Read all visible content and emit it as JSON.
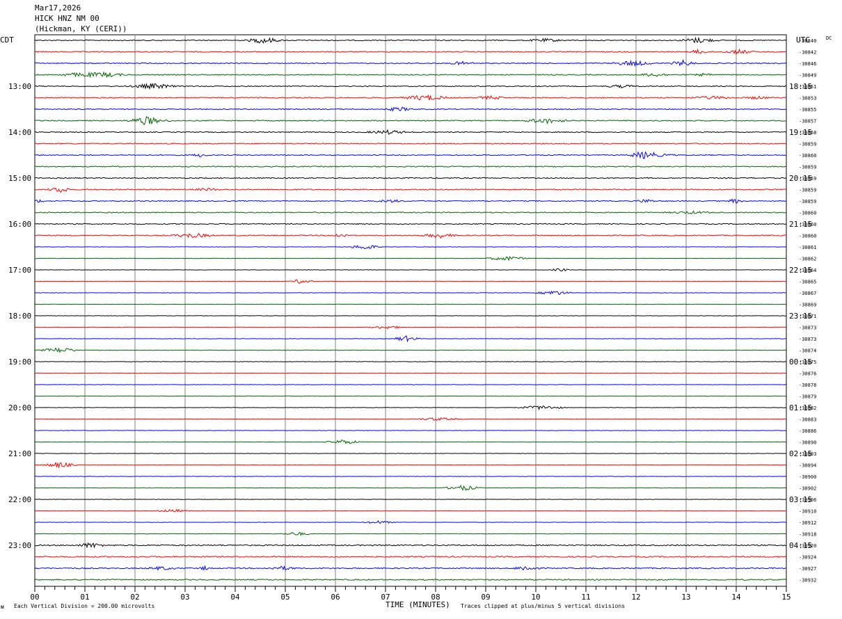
{
  "header": {
    "date": "Mar17,2026",
    "station": "HICK HNZ NM 00",
    "location": "(Hickman, KY (CERI))"
  },
  "chart_data": {
    "type": "line",
    "title": "HICK HNZ NM 00",
    "left_zone_label": "CDT",
    "right_zone_label": "UTC",
    "dc_label": "DC",
    "xlabel": "TIME (MINUTES)",
    "xlim": [
      0,
      15
    ],
    "x_ticks": [
      "00",
      "01",
      "02",
      "03",
      "04",
      "05",
      "06",
      "07",
      "08",
      "09",
      "10",
      "11",
      "12",
      "13",
      "14",
      "15"
    ],
    "left_hour_labels": [
      "13:00",
      "14:00",
      "15:00",
      "16:00",
      "17:00",
      "18:00",
      "19:00",
      "20:00",
      "21:00",
      "22:00",
      "23:00"
    ],
    "right_hour_labels": [
      "18:15",
      "19:15",
      "20:15",
      "21:15",
      "22:15",
      "23:15",
      "00:15",
      "01:15",
      "02:15",
      "03:15",
      "04:15"
    ],
    "trace_colors": [
      "#000000",
      "#ff0000",
      "#0000ff",
      "#006400"
    ],
    "dc_offsets": [
      "-30840",
      "-30842",
      "-30846",
      "-30849",
      "-30851",
      "-30853",
      "-30855",
      "-30857",
      "-30858",
      "-30859",
      "-30860",
      "-30859",
      "-30859",
      "-30859",
      "-30859",
      "-30860",
      "-30860",
      "-30860",
      "-30861",
      "-30862",
      "-30864",
      "-30865",
      "-30867",
      "-30869",
      "-30871",
      "-30873",
      "-30873",
      "-30874",
      "-30875",
      "-30876",
      "-30878",
      "-30879",
      "-30882",
      "-30883",
      "-30886",
      "-30890",
      "-30893",
      "-30894",
      "-30900",
      "-30902",
      "-30906",
      "-30910",
      "-30912",
      "-30918",
      "-30920",
      "-30924",
      "-30927",
      "-30932"
    ],
    "footer_left": "Each Vertical Division =  200.00 microvolts",
    "footer_right": "Traces clipped at plus/minus 5 vertical divisions"
  }
}
